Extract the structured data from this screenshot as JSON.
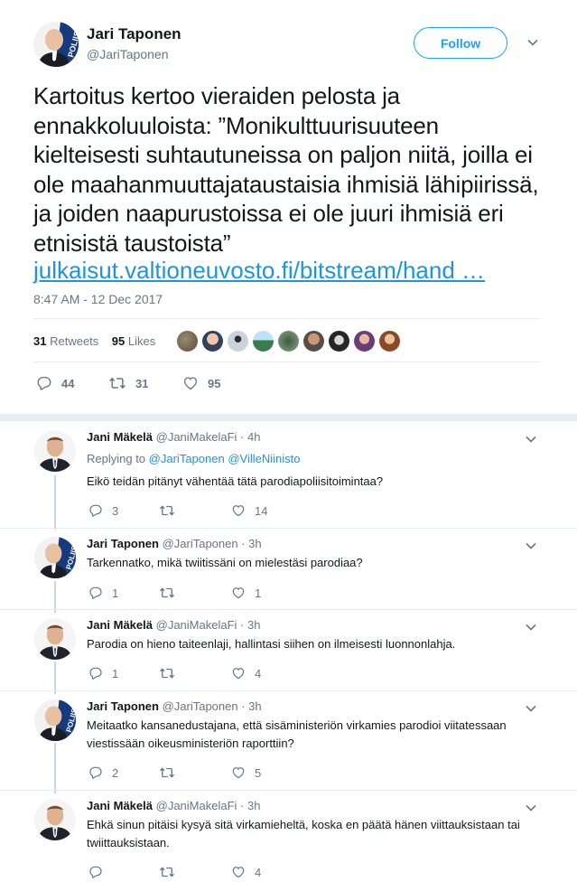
{
  "main_tweet": {
    "author_name": "Jari Taponen",
    "author_handle": "@JariTaponen",
    "follow_label": "Follow",
    "text": "Kartoitus kertoo vieraiden pelosta ja ennakkoluuloista: ”Monikulttuurisuuteen kielteisesti suhtautuneissa on paljon niitä, joilla ei ole maahanmuuttajataustaisia ihmisiä lähipiirissä, ja joiden naapurustoissa ei ole juuri ihmisiä eri etnisistä taustoista”",
    "link": "julkaisut.valtioneuvosto.fi/bitstream/hand …",
    "time": "8:47 AM - 12 Dec 2017",
    "retweets_count": "31",
    "retweets_label": "Retweets",
    "likes_count": "95",
    "likes_label": "Likes",
    "actions": {
      "replies": "44",
      "retweets": "31",
      "likes": "95"
    }
  },
  "replies": [
    {
      "name": "Jani Mäkelä",
      "handle": "@JaniMakelaFi",
      "time": "· 4h",
      "replying_to_label": "Replying to",
      "replying_to_1": "@JariTaponen",
      "replying_to_2": "@VilleNiinisto",
      "text": "Eikö teidän pitänyt vähentää tätä parodiapoliisitoimintaa?",
      "replies": "3",
      "retweets": "",
      "likes": "14"
    },
    {
      "name": "Jari Taponen",
      "handle": "@JariTaponen",
      "time": "· 3h",
      "text": "Tarkennatko, mikä twiitissäni on mielestäsi parodiaa?",
      "replies": "1",
      "retweets": "",
      "likes": "1"
    },
    {
      "name": "Jani Mäkelä",
      "handle": "@JaniMakelaFi",
      "time": "· 3h",
      "text": "Parodia on hieno taiteenlaji, hallintasi siihen on ilmeisesti luonnonlahja.",
      "replies": "1",
      "retweets": "",
      "likes": "4"
    },
    {
      "name": "Jari Taponen",
      "handle": "@JariTaponen",
      "time": "· 3h",
      "text": "Meitaatko kansanedustajana, että sisäministeriön virkamies parodioi viitatessaan viestissään oikeusministeriön raporttiin?",
      "replies": "2",
      "retweets": "",
      "likes": "5"
    },
    {
      "name": "Jani Mäkelä",
      "handle": "@JaniMakelaFi",
      "time": "· 3h",
      "text": "Ehkä sinun pitäisi kysyä sitä virkamieheltä, koska en päätä hänen viittauksistaan tai twiittauksistaan.",
      "replies": "",
      "retweets": "",
      "likes": "4"
    }
  ],
  "icons": {
    "reply": "reply-icon",
    "retweet": "retweet-icon",
    "like": "heart-icon",
    "more": "chevron-down-icon"
  },
  "colors": {
    "accent": "#1da1f2",
    "link": "#1b95e0",
    "muted": "#657786",
    "text": "#14171a",
    "divider": "#e6ecf0",
    "thread": "#c4d8e6"
  }
}
